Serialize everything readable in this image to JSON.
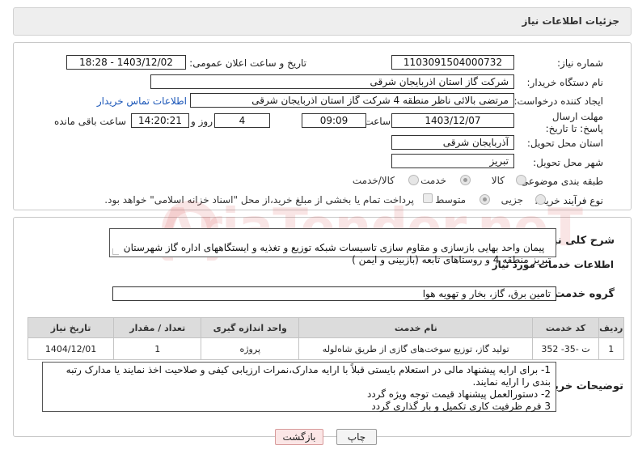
{
  "header": {
    "title": "جزئیات اطلاعات نیاز"
  },
  "form": {
    "need_number": {
      "label": "شماره نیاز:",
      "value": "1103091504000732"
    },
    "announce_datetime": {
      "label": "تاریخ و ساعت اعلان عمومی:",
      "value": "1403/12/02 - 18:28"
    },
    "buyer_org": {
      "label": "نام دستگاه خریدار:",
      "value": "شرکت گاز استان اذربایجان شرقی"
    },
    "requester": {
      "label": "ایجاد کننده درخواست:",
      "value": "مرتضی بالائی ناظر منطقه 4 شرکت گاز استان اذربایجان شرقی",
      "contact_link": "اطلاعات تماس خریدار"
    },
    "deadline": {
      "label": "مهلت ارسال پاسخ: تا تاریخ:",
      "date": "1403/12/07",
      "time_label": "ساعت",
      "time": "09:09",
      "days": "4",
      "days_label": "روز و",
      "remaining": "14:20:21",
      "remaining_label": "ساعت باقی مانده"
    },
    "province": {
      "label": "استان محل تحویل:",
      "value": "آذربایجان شرقی"
    },
    "city": {
      "label": "شهر محل تحویل:",
      "value": "تبریز"
    },
    "category": {
      "label": "طبقه بندی موضوعی:",
      "options": [
        "کالا",
        "خدمت",
        "کالا/خدمت"
      ],
      "selected": "خدمت"
    },
    "purchase_type": {
      "label": "نوع فرآیند خرید :",
      "options": [
        "جزیی",
        "متوسط"
      ],
      "selected": "متوسط",
      "checkbox_text": "پرداخت تمام یا بخشی از مبلغ خرید،از محل \"اسناد خزانه اسلامی\" خواهد بود."
    }
  },
  "summary": {
    "label": "شرح کلی نیاز:",
    "text": "پیمان واحد بهایی بازسازی و مقاوم سازی تاسیسات شبکه توزیع و تغذیه و ایستگاههای اداره گاز شهرستان تبریز منطقه 4 و روستاهای تابعه (بازبینی و ایمن )"
  },
  "services": {
    "section_title": "اطلاعات خدمات مورد نیاز",
    "group_label": "گروه خدمت:",
    "group_value": "تامین برق، گاز، بخار و تهویه هوا",
    "columns": [
      "ردیف",
      "کد خدمت",
      "نام خدمت",
      "واحد اندازه گیری",
      "تعداد / مقدار",
      "تاریخ نیاز"
    ],
    "rows": [
      [
        "1",
        "ت -35- 352",
        "تولید گاز، توزیع سوخت‌های گازی از طریق شاه‌لوله",
        "پروژه",
        "1",
        "1404/12/01"
      ]
    ]
  },
  "buyer_notes": {
    "label": "توضیحات خریدار:",
    "text": "1- برای ارایه پیشنهاد مالی در استعلام بایستی قبلاً با ارایه مدارک،نمرات ارزیابی کیفی و صلاحیت اخذ نمایند یا مدارک رتبه بندی را ارایه نمایند.\n2- دستورالعمل پیشنهاد قیمت توجه ویژه گردد\n3 فرم ظرفیت کاری تکمیل و بار گذاری گردد"
  },
  "buttons": {
    "print": "چاپ",
    "back": "بازگشت"
  },
  "watermark": "AriaTender.neT"
}
